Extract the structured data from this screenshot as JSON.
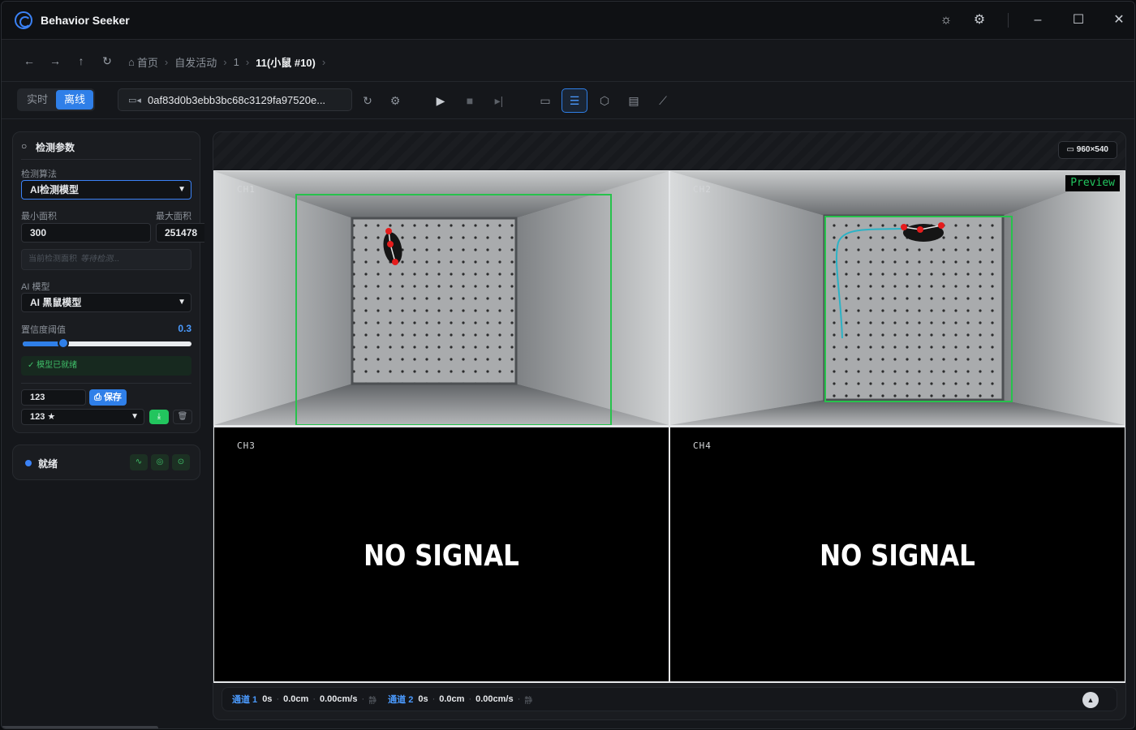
{
  "app": {
    "title": "Behavior Seeker"
  },
  "breadcrumb": {
    "items": [
      "首页",
      "自发活动",
      "1"
    ],
    "current": "11(小鼠 #10)"
  },
  "toolbar": {
    "mode_realtime": "实时",
    "mode_offline": "离线",
    "source_id": "0af83d0b3ebb3bc68c3129fa97520e..."
  },
  "panel": {
    "title": "检测参数",
    "algo_label": "检测算法",
    "algo_value": "AI检测模型",
    "min_area_label": "最小面积",
    "max_area_label": "最大面积",
    "min_area_value": "300",
    "max_area_value": "251478",
    "current_area_label": "当前检测面积",
    "current_area_placeholder": "等待检测...",
    "model_label": "AI 模型",
    "model_value": "AI 黑鼠模型",
    "confidence_label": "置信度阈值",
    "confidence_value": "0.3",
    "confidence_fraction": 0.24,
    "model_ready": "✓ 模型已就绪",
    "preset_name": "123",
    "save_label": "保存",
    "preset_select": "123 ★"
  },
  "status": {
    "text": "就绪",
    "color": "#3b82f6"
  },
  "video": {
    "resolution": "960×540",
    "channels": [
      {
        "label": "CH1",
        "signal": true
      },
      {
        "label": "CH2",
        "signal": true,
        "preview": "Preview"
      },
      {
        "label": "CH3",
        "signal": false,
        "no_signal": "NO SIGNAL"
      },
      {
        "label": "CH4",
        "signal": false,
        "no_signal": "NO SIGNAL"
      }
    ]
  },
  "stats": {
    "ch1": {
      "label": "通道 1",
      "time": "0s",
      "dist": "0.0cm",
      "speed": "0.00cm/s",
      "state": "静"
    },
    "ch2": {
      "label": "通道 2",
      "time": "0s",
      "dist": "0.0cm",
      "speed": "0.00cm/s",
      "state": "静"
    }
  },
  "colors": {
    "accent": "#2f7fe8",
    "success": "#22c55e",
    "detect_box": "#27c24c",
    "keypoint": "#e51c1c",
    "trail": "#2bb3c6"
  }
}
